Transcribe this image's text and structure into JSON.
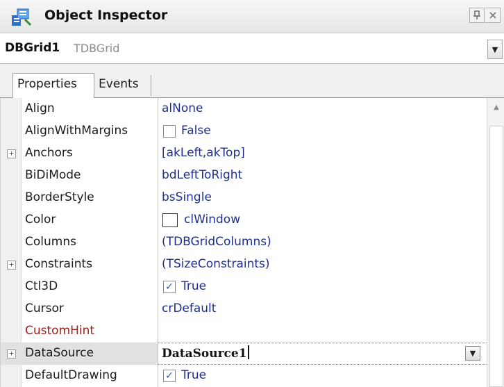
{
  "window": {
    "title": "Object Inspector",
    "pin_glyph": "📌",
    "close_glyph": "✕"
  },
  "component": {
    "name": "DBGrid1",
    "type": "TDBGrid",
    "dropdown_glyph": "▼"
  },
  "tabs": [
    {
      "label": "Properties",
      "active": true
    },
    {
      "label": "Events",
      "active": false
    }
  ],
  "properties": [
    {
      "name": "Align",
      "value": "alNone"
    },
    {
      "name": "AlignWithMargins",
      "value": "False",
      "checkbox": false
    },
    {
      "name": "Anchors",
      "value": "[akLeft,akTop]",
      "expandable": true
    },
    {
      "name": "BiDiMode",
      "value": "bdLeftToRight"
    },
    {
      "name": "BorderStyle",
      "value": "bsSingle"
    },
    {
      "name": "Color",
      "value": "clWindow",
      "color_swatch": "#ffffff"
    },
    {
      "name": "Columns",
      "value": "(TDBGridColumns)"
    },
    {
      "name": "Constraints",
      "value": "(TSizeConstraints)",
      "expandable": true
    },
    {
      "name": "Ctl3D",
      "value": "True",
      "checkbox": true
    },
    {
      "name": "Cursor",
      "value": "crDefault"
    },
    {
      "name": "CustomHint",
      "value": "",
      "highlight_color": "#a0201a"
    },
    {
      "name": "DataSource",
      "value": "DataSource1",
      "expandable": true,
      "selected": true,
      "editing": true
    },
    {
      "name": "DefaultDrawing",
      "value": "True",
      "checkbox": true
    }
  ],
  "expander_glyph": "+",
  "check_glyph": "✓",
  "scroll_up_glyph": "▲",
  "colors": {
    "value_text": "#1f2f8f",
    "selected_row": "#e1e1e1",
    "gutter": "#f0f0f0"
  }
}
